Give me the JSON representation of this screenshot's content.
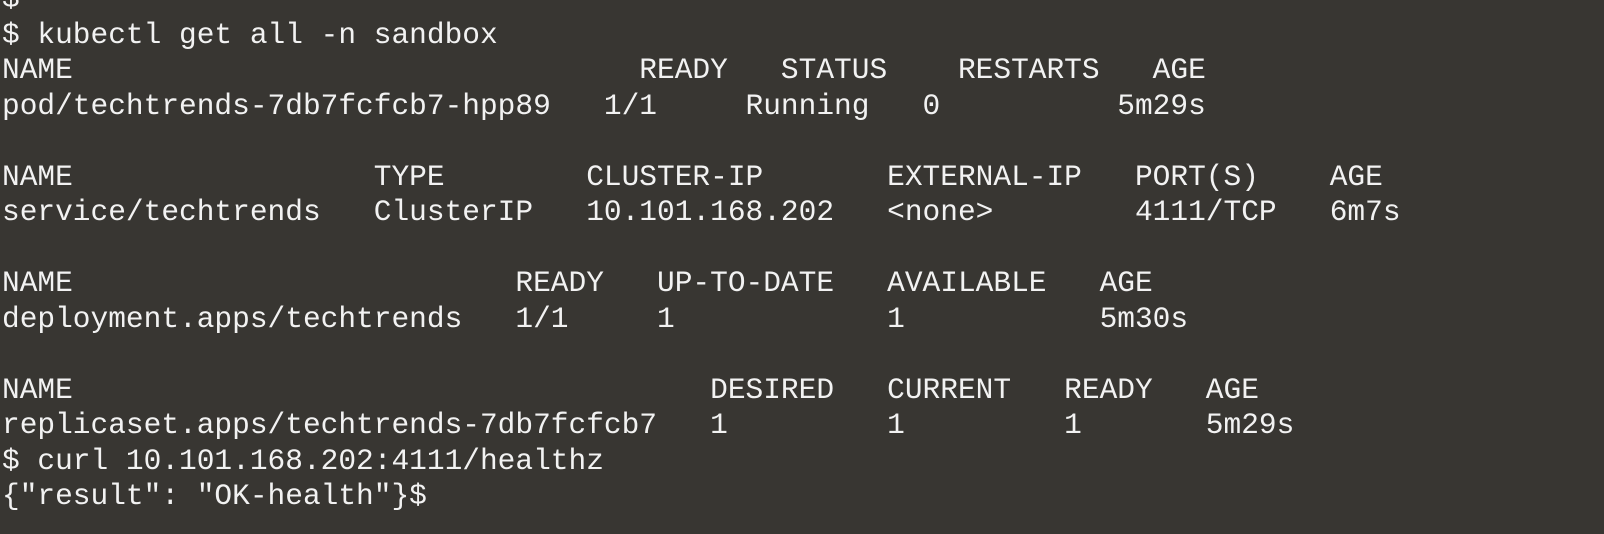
{
  "terminal": {
    "lines": [
      "$",
      "$ kubectl get all -n sandbox",
      "NAME                                READY   STATUS    RESTARTS   AGE",
      "pod/techtrends-7db7fcfcb7-hpp89   1/1     Running   0          5m29s",
      "",
      "NAME                 TYPE        CLUSTER-IP       EXTERNAL-IP   PORT(S)    AGE",
      "service/techtrends   ClusterIP   10.101.168.202   <none>        4111/TCP   6m7s",
      "",
      "NAME                         READY   UP-TO-DATE   AVAILABLE   AGE",
      "deployment.apps/techtrends   1/1     1            1           5m30s",
      "",
      "NAME                                    DESIRED   CURRENT   READY   AGE",
      "replicaset.apps/techtrends-7db7fcfcb7   1         1         1       5m29s",
      "$ curl 10.101.168.202:4111/healthz",
      "{\"result\": \"OK-health\"}$"
    ]
  }
}
